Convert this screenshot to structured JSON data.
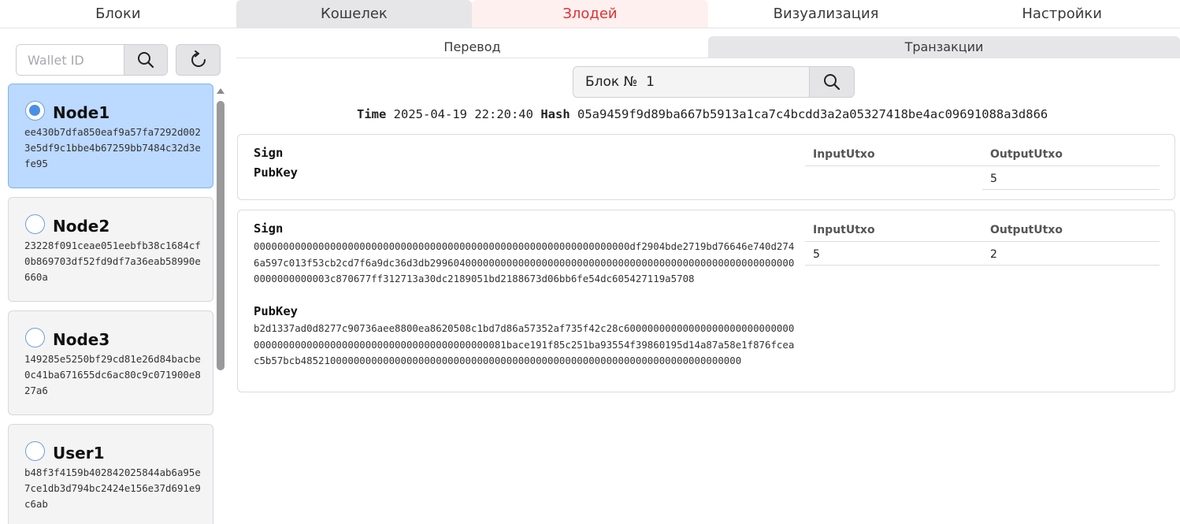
{
  "top_tabs": [
    "Блоки",
    "Кошелек",
    "Злодей",
    "Визуализация",
    "Настройки"
  ],
  "sidebar": {
    "wallet_placeholder": "Wallet ID",
    "nodes": [
      {
        "name": "Node1",
        "hash": "ee430b7dfa850eaf9a57fa7292d0023e5df9c1bbe4b67259bb7484c32d3efe95",
        "selected": true
      },
      {
        "name": "Node2",
        "hash": "23228f091ceae051eebfb38c1684cf0b869703df52fd9df7a36eab58990e660a",
        "selected": false
      },
      {
        "name": "Node3",
        "hash": "149285e5250bf29cd81e26d84bacbe0c41ba671655dc6ac80c9c071900e827a6",
        "selected": false
      },
      {
        "name": "User1",
        "hash": "b48f3f4159b402842025844ab6a95e7ce1db3d794bc2424e156e37d691e9c6ab",
        "selected": false
      }
    ]
  },
  "sub_tabs": [
    "Перевод",
    "Транзакции"
  ],
  "block_search": {
    "value": "Блок №  1"
  },
  "block_meta": {
    "time_label": "Time",
    "time_value": "2025-04-19 22:20:40",
    "hash_label": "Hash",
    "hash_value": "05a9459f9d89ba667b5913a1ca7c4bcdd3a2a05327418be4ac09691088a3d866"
  },
  "transactions": [
    {
      "sign_label": "Sign",
      "sign": "",
      "pubkey_label": "PubKey",
      "pubkey": "",
      "input_header": "InputUtxo",
      "output_header": "OutputUtxo",
      "input_utxo": "",
      "output_utxo": "5"
    },
    {
      "sign_label": "Sign",
      "sign": "0000000000000000000000000000000000000000000000000000000000000000df2904bde2719bd76646e740d2746a597c013f53cb2cd7f6a9dc36d3db299604000000000000000000000000000000000000000000000000000000000000000000003c870677ff312713a30dc2189051bd2188673d06bb6fe54dc605427119a5708",
      "pubkey_label": "PubKey",
      "pubkey": "b2d1337ad0d8277c90736aee8800ea8620508c1bd7d86a57352af735f42c28c600000000000000000000000000000000000000000000000000000000000000000000081bace191f85c251ba93554f39860195d14a87a58e1f876fceac5b57bcb485210000000000000000000000000000000000000000000000000000000000000000000000",
      "input_header": "InputUtxo",
      "output_header": "OutputUtxo",
      "input_utxo": "5",
      "output_utxo": "2"
    }
  ]
}
